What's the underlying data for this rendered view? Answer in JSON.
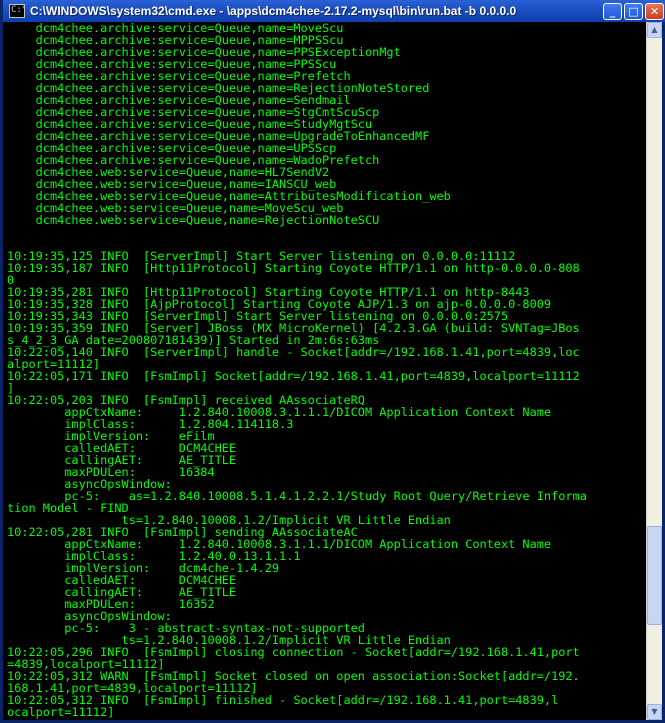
{
  "window": {
    "title": "C:\\WINDOWS\\system32\\cmd.exe - \\apps\\dcm4chee-2.17.2-mysql\\bin\\run.bat -b 0.0.0.0",
    "icon_label": "C:\\",
    "minimize_glyph": "_",
    "maximize_glyph": "□",
    "close_glyph": "✕"
  },
  "scrollbar": {
    "up_glyph": "▲",
    "down_glyph": "▼",
    "position_fraction": 0.86
  },
  "console": {
    "lines": [
      "    dcm4chee.archive:service=Queue,name=MoveScu",
      "    dcm4chee.archive:service=Queue,name=MPPSScu",
      "    dcm4chee.archive:service=Queue,name=PPSExceptionMgt",
      "    dcm4chee.archive:service=Queue,name=PPSScu",
      "    dcm4chee.archive:service=Queue,name=Prefetch",
      "    dcm4chee.archive:service=Queue,name=RejectionNoteStored",
      "    dcm4chee.archive:service=Queue,name=Sendmail",
      "    dcm4chee.archive:service=Queue,name=StgCmtScuScp",
      "    dcm4chee.archive:service=Queue,name=StudyMgtScu",
      "    dcm4chee.archive:service=Queue,name=UpgradeToEnhancedMF",
      "    dcm4chee.archive:service=Queue,name=UPSScp",
      "    dcm4chee.archive:service=Queue,name=WadoPrefetch",
      "    dcm4chee.web:service=Queue,name=HL7SendV2",
      "    dcm4chee.web:service=Queue,name=IANSCU_web",
      "    dcm4chee.web:service=Queue,name=AttributesModification_web",
      "    dcm4chee.web:service=Queue,name=MoveScu_web",
      "    dcm4chee.web:service=Queue,name=RejectionNoteSCU",
      "",
      "",
      "10:19:35,125 INFO  [ServerImpl] Start Server listening on 0.0.0.0:11112",
      "10:19:35,187 INFO  [Http11Protocol] Starting Coyote HTTP/1.1 on http-0.0.0.0-808",
      "0",
      "10:19:35,281 INFO  [Http11Protocol] Starting Coyote HTTP/1.1 on http-8443",
      "10:19:35,328 INFO  [AjpProtocol] Starting Coyote AJP/1.3 on ajp-0.0.0.0-8009",
      "10:19:35,343 INFO  [ServerImpl] Start Server listening on 0.0.0.0:2575",
      "10:19:35,359 INFO  [Server] JBoss (MX MicroKernel) [4.2.3.GA (build: SVNTag=JBos",
      "s_4_2_3_GA date=200807181439)] Started in 2m:6s:63ms",
      "10:22:05,140 INFO  [ServerImpl] handle - Socket[addr=/192.168.1.41,port=4839,loc",
      "alport=11112]",
      "10:22:05,171 INFO  [FsmImpl] Socket[addr=/192.168.1.41,port=4839,localport=11112",
      "]",
      "10:22:05,203 INFO  [FsmImpl] received AAssociateRQ",
      "        appCtxName:     1.2.840.10008.3.1.1.1/DICOM Application Context Name",
      "        implClass:      1.2.804.114118.3",
      "        implVersion:    eFilm",
      "        calledAET:      DCM4CHEE",
      "        callingAET:     AE_TITLE",
      "        maxPDULen:      16384",
      "        asyncOpsWindow:",
      "        pc-5:    as=1.2.840.10008.5.1.4.1.2.2.1/Study Root Query/Retrieve Informa",
      "tion Model - FIND",
      "                ts=1.2.840.10008.1.2/Implicit VR Little Endian",
      "10:22:05,281 INFO  [FsmImpl] sending AAssociateAC",
      "        appCtxName:     1.2.840.10008.3.1.1.1/DICOM Application Context Name",
      "        implClass:      1.2.40.0.13.1.1.1",
      "        implVersion:    dcm4che-1.4.29",
      "        calledAET:      DCM4CHEE",
      "        callingAET:     AE_TITLE",
      "        maxPDULen:      16352",
      "        asyncOpsWindow:",
      "        pc-5:    3 - abstract-syntax-not-supported",
      "                ts=1.2.840.10008.1.2/Implicit VR Little Endian",
      "10:22:05,296 INFO  [FsmImpl] closing connection - Socket[addr=/192.168.1.41,port",
      "=4839,localport=11112]",
      "10:22:05,312 WARN  [FsmImpl] Socket closed on open association:Socket[addr=/192.",
      "168.1.41,port=4839,localport=11112]",
      "10:22:05,312 INFO  [FsmImpl] finished - Socket[addr=/192.168.1.41,port=4839,l",
      "ocalport=11112]"
    ]
  }
}
